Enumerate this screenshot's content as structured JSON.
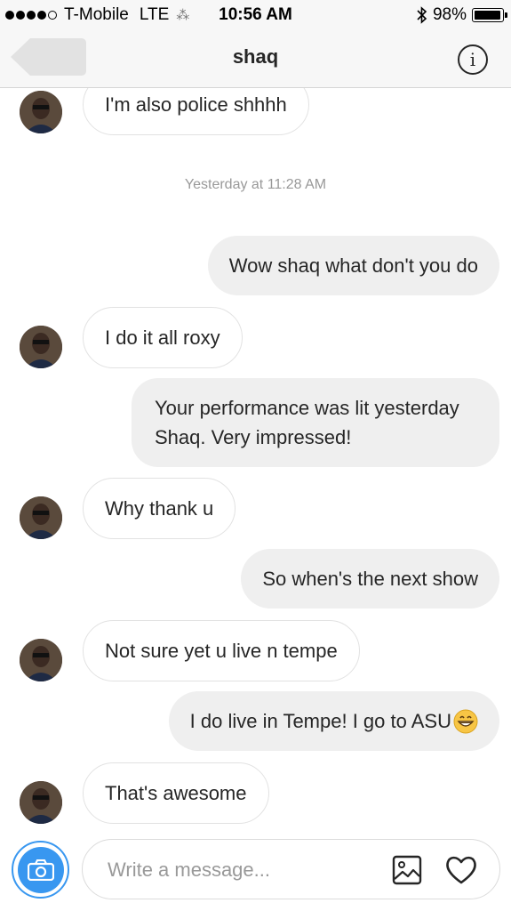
{
  "status_bar": {
    "carrier": "T-Mobile",
    "network": "LTE",
    "time": "10:56 AM",
    "battery_percent": "98%",
    "battery_level": 0.98,
    "signal_bars_filled": 4,
    "signal_bars_total": 5
  },
  "header": {
    "title": "shaq",
    "back_icon": "back-arrow-icon",
    "info_icon": "info-icon",
    "info_glyph": "i"
  },
  "thread": {
    "messages": [
      {
        "sender": "shaq",
        "text": "I'm also police shhhh"
      },
      {
        "type": "timestamp",
        "text": "Yesterday at 11:28 AM"
      },
      {
        "sender": "me",
        "text": "Wow shaq what don't you do"
      },
      {
        "sender": "shaq",
        "text": "I do it all roxy"
      },
      {
        "sender": "me",
        "text": "Your performance was lit yesterday Shaq. Very impressed!"
      },
      {
        "sender": "shaq",
        "text": "Why thank u"
      },
      {
        "sender": "me",
        "text": "So when's the next show"
      },
      {
        "sender": "shaq",
        "text": "Not sure yet u live n tempe"
      },
      {
        "sender": "me",
        "text": "I do live in Tempe! I go to ASU",
        "emoji": "grinning-face-icon"
      },
      {
        "sender": "shaq",
        "text": "That's awesome"
      }
    ]
  },
  "composer": {
    "placeholder": "Write a message...",
    "camera_icon": "camera-icon",
    "gallery_icon": "image-gallery-icon",
    "like_icon": "heart-icon"
  },
  "colors": {
    "accent": "#3897f0",
    "outgoing_bubble": "#efefef",
    "incoming_border": "#e2e2e2",
    "timestamp_text": "#999999"
  }
}
